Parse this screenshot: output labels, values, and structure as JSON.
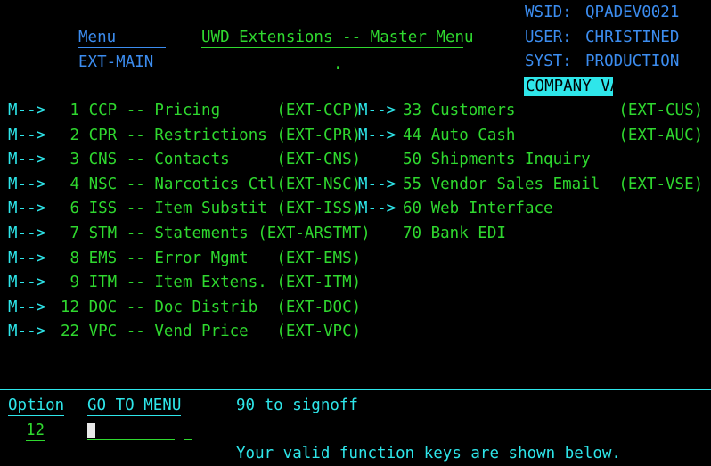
{
  "header": {
    "menu_label": "Menu",
    "menu_code": "EXT-MAIN",
    "title": "UWD Extensions -- Master Menu",
    "dot": ".",
    "wsid_label": "WSID:",
    "wsid_value": "QPADEV0021",
    "user_label": "USER:",
    "user_value": "CHRISTINED",
    "syst_label": "SYST:",
    "syst_value": "PRODUCTION",
    "company": "COMPANY VA"
  },
  "left_items": [
    {
      "marker": "M-->",
      "text": " 1 CCP -- Pricing      (EXT-CCP)"
    },
    {
      "marker": "M-->",
      "text": " 2 CPR -- Restrictions (EXT-CPR)"
    },
    {
      "marker": "M-->",
      "text": " 3 CNS -- Contacts     (EXT-CNS)"
    },
    {
      "marker": "M-->",
      "text": " 4 NSC -- Narcotics Ctl(EXT-NSC)"
    },
    {
      "marker": "M-->",
      "text": " 6 ISS -- Item Substit (EXT-ISS)"
    },
    {
      "marker": "M-->",
      "text": " 7 STM -- Statements (EXT-ARSTMT)"
    },
    {
      "marker": "M-->",
      "text": " 8 EMS -- Error Mgmt   (EXT-EMS)"
    },
    {
      "marker": "M-->",
      "text": " 9 ITM -- Item Extens. (EXT-ITM)"
    },
    {
      "marker": "M-->",
      "text": "12 DOC -- Doc Distrib  (EXT-DOC)"
    },
    {
      "marker": "M-->",
      "text": "22 VPC -- Vend Price   (EXT-VPC)"
    }
  ],
  "right_items": [
    {
      "marker": "M-->",
      "text": "33 Customers           (EXT-CUS)"
    },
    {
      "marker": "M-->",
      "text": "44 Auto Cash           (EXT-AUC)"
    },
    {
      "marker": "",
      "text": "50 Shipments Inquiry"
    },
    {
      "marker": "M-->",
      "text": "55 Vendor Sales Email  (EXT-VSE)"
    },
    {
      "marker": "M-->",
      "text": "60 Web Interface"
    },
    {
      "marker": "",
      "text": "70 Bank EDI"
    }
  ],
  "footer": {
    "option_label": "Option",
    "option_value": "12",
    "goto_label": "GO TO MENU",
    "signoff_text": "90 to signoff",
    "function_keys_text": "Your valid function keys are shown below."
  },
  "colors": {
    "background": "#000000",
    "blue": "#3c8df0",
    "green": "#2fd82f",
    "cyan": "#2ee6ea"
  }
}
